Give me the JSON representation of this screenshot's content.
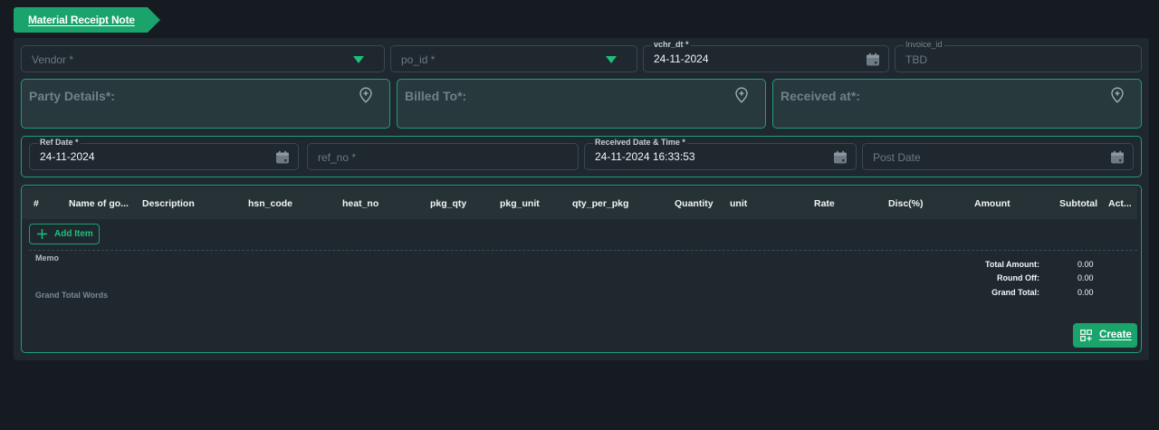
{
  "page": {
    "title": "Material Receipt Note"
  },
  "header_fields": {
    "vendor": {
      "placeholder": "Vendor *"
    },
    "po_id": {
      "placeholder": "po_id *"
    },
    "vchr_dt": {
      "label": "vchr_dt *",
      "value": "24-11-2024"
    },
    "invoice_id": {
      "label": "Invoice_id",
      "value": "TBD"
    }
  },
  "address_boxes": {
    "party": {
      "label": "Party Details*:"
    },
    "billed": {
      "label": "Billed To*:"
    },
    "received": {
      "label": "Received at*:"
    }
  },
  "ref_fields": {
    "ref_date": {
      "label": "Ref Date *",
      "value": "24-11-2024"
    },
    "ref_no": {
      "placeholder": "ref_no *"
    },
    "received_dt": {
      "label": "Received Date & Time *",
      "value": "24-11-2024 16:33:53"
    },
    "post_date": {
      "placeholder": "Post Date"
    }
  },
  "table": {
    "columns": [
      "#",
      "Name of go...",
      "Description",
      "hsn_code",
      "heat_no",
      "pkg_qty",
      "pkg_unit",
      "qty_per_pkg",
      "Quantity",
      "unit",
      "Rate",
      "Disc(%)",
      "Amount",
      "Subtotal",
      "Act..."
    ]
  },
  "add_item_label": "Add Item",
  "memo_label": "Memo",
  "grand_total_words_label": "Grand Total Words",
  "totals": [
    {
      "label": "Total Amount:",
      "value": "0.00"
    },
    {
      "label": "Round Off:",
      "value": "0.00"
    },
    {
      "label": "Grand Total:",
      "value": "0.00"
    }
  ],
  "create_label": "Create",
  "colors": {
    "accent": "#1aa36b",
    "border_accent": "#1f9e77",
    "bg": "#161b21",
    "panel": "#1f282f"
  },
  "icons": [
    "dropdown-arrow-icon",
    "calendar-icon",
    "location-pin-icon",
    "plus-icon",
    "create-grid-icon"
  ]
}
